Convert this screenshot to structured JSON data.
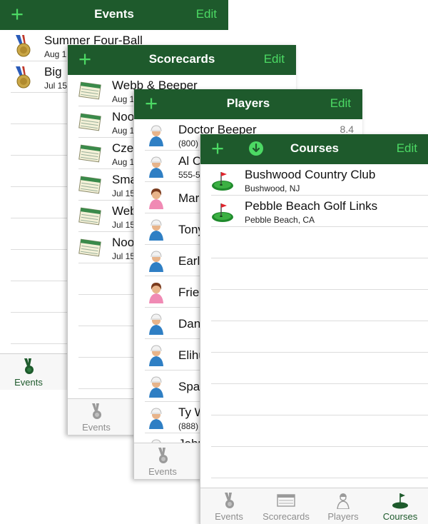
{
  "colors": {
    "nav_bar": "#1e5a2c",
    "accent": "#4cd964",
    "tab_active": "#1e5a2c",
    "tab_inactive": "#8e8e8e"
  },
  "nav": {
    "add_icon": "plus-icon",
    "edit_label": "Edit",
    "plus_label": "+"
  },
  "events_screen": {
    "title": "Events",
    "items": [
      {
        "name": "Summer Four-Ball",
        "date": "Aug 1",
        "icon": "medal-icon"
      },
      {
        "name": "Big",
        "date": "Jul 15",
        "icon": "medal-icon"
      }
    ],
    "tabs": [
      "Events",
      "Sc"
    ]
  },
  "scorecards_screen": {
    "title": "Scorecards",
    "items": [
      {
        "name": "Webb & Beeper",
        "date": "Aug 1"
      },
      {
        "name": "Noo",
        "date": "Aug 1"
      },
      {
        "name": "Cze",
        "date": "Aug 1"
      },
      {
        "name": "Sma",
        "date": "Jul 15"
      },
      {
        "name": "Web",
        "date": "Jul 15"
      },
      {
        "name": "Noo",
        "date": "Jul 15"
      }
    ],
    "tabs": [
      "Events",
      "Sc"
    ]
  },
  "players_screen": {
    "title": "Players",
    "items": [
      {
        "name": "Doctor Beeper",
        "sub": "(800)",
        "detail": "8.4",
        "gender": "m"
      },
      {
        "name": "Al C",
        "sub": "555-5",
        "detail": "",
        "gender": "m"
      },
      {
        "name": "Mar",
        "sub": "",
        "detail": "",
        "gender": "f"
      },
      {
        "name": "Tony",
        "sub": "",
        "detail": "",
        "gender": "m"
      },
      {
        "name": "Earl",
        "sub": "",
        "detail": "",
        "gender": "m"
      },
      {
        "name": "Fried",
        "sub": "",
        "detail": "",
        "gender": "f"
      },
      {
        "name": "Dan",
        "sub": "",
        "detail": "",
        "gender": "m"
      },
      {
        "name": "Elihu",
        "sub": "",
        "detail": "",
        "gender": "m"
      },
      {
        "name": "Spa",
        "sub": "",
        "detail": "",
        "gender": "m"
      },
      {
        "name": "Ty W",
        "sub": "(888)",
        "detail": "",
        "gender": "m"
      },
      {
        "name": "John",
        "sub": "",
        "detail": "",
        "gender": "m"
      }
    ],
    "tabs": [
      "Events",
      "Sc"
    ]
  },
  "courses_screen": {
    "title": "Courses",
    "download_icon": "download-icon",
    "items": [
      {
        "name": "Bushwood Country Club",
        "sub": "Bushwood, NJ"
      },
      {
        "name": "Pebble Beach Golf Links",
        "sub": "Pebble Beach, CA"
      }
    ],
    "tabs": [
      "Events",
      "Scorecards",
      "Players",
      "Courses"
    ],
    "active_tab": "Courses"
  }
}
